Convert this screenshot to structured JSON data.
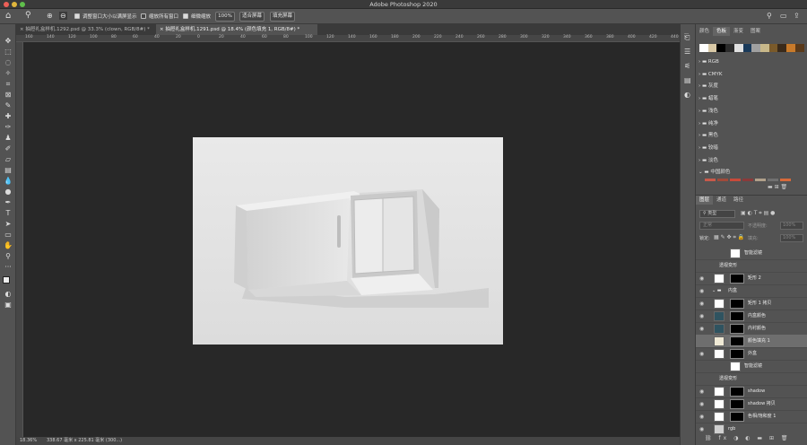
{
  "window": {
    "title": "Adobe Photoshop 2020"
  },
  "options": {
    "resize_label": "调整窗口大小以满屏显示",
    "zoom_all_label": "缩放所有窗口",
    "scrubby_label": "细微缩放",
    "zoom_value": "100%",
    "fit_label": "适合屏幕",
    "fill_label": "填充屏幕"
  },
  "tabs": [
    {
      "label": "抽屉礼盒样机.1292.psd @ 33.3% (clown, RGB/8#) *"
    },
    {
      "label": "抽屉礼盒样机.1291.psd @ 18.4% (颜色填充 1, RGB/8#) *"
    }
  ],
  "ruler": [
    "160",
    "140",
    "120",
    "100",
    "80",
    "60",
    "40",
    "20",
    "0",
    "20",
    "40",
    "60",
    "80",
    "100",
    "120",
    "140",
    "160",
    "180",
    "200",
    "220",
    "240",
    "260",
    "280",
    "300",
    "320",
    "340",
    "360",
    "380",
    "400",
    "420",
    "440",
    "460"
  ],
  "status": {
    "zoom": "18.36%",
    "doc": "338.67 毫米 x 225.81 毫米 (300...)"
  },
  "swatches_panel": {
    "tabs": [
      "颜色",
      "色板",
      "渐变",
      "图案"
    ],
    "active": "色板",
    "colors": [
      "#ffffff",
      "#d9c9a6",
      "#000000",
      "#2b2b2b",
      "#e0e0e0",
      "#1a3a5a",
      "#a0a0a0",
      "#c8b88a",
      "#7a5a2a",
      "#3a2a1a",
      "#c87a2a",
      "#5a3a1a"
    ],
    "groups": [
      "RGB",
      "CMYK",
      "灰度",
      "蜡笔",
      "浅色",
      "纯净",
      "黑色",
      "较暗",
      "淡色",
      "中国颜色"
    ],
    "bottom_colors": [
      "#c85a4a",
      "#a04a3a",
      "#c84a3a",
      "#8a3a3a",
      "#b0a08a",
      "#707070",
      "#d86a3a"
    ]
  },
  "layers_panel": {
    "tabs": [
      "图层",
      "通道",
      "路径"
    ],
    "filter_label": "类型",
    "blend_mode": "正常",
    "opacity_label": "不透明度:",
    "opacity": "100%",
    "lock_label": "锁定:",
    "fill_label": "填充:",
    "fill": "100%"
  },
  "layers": [
    {
      "name": "智能滤镜",
      "kind": "filter"
    },
    {
      "name": "透视变形",
      "kind": "sub"
    },
    {
      "name": "矩形 2",
      "kind": "layer"
    },
    {
      "name": "内盒",
      "kind": "group"
    },
    {
      "name": "矩形 1 拷贝",
      "kind": "layer"
    },
    {
      "name": "内盒颜色",
      "kind": "layer"
    },
    {
      "name": "内衬颜色",
      "kind": "layer"
    },
    {
      "name": "颜色填充 1",
      "kind": "layer"
    },
    {
      "name": "外盒",
      "kind": "layer"
    },
    {
      "name": "智能滤镜",
      "kind": "filter"
    },
    {
      "name": "透视变形",
      "kind": "sub"
    },
    {
      "name": "shadow",
      "kind": "layer"
    },
    {
      "name": "shadow 拷贝",
      "kind": "layer"
    },
    {
      "name": "色相/饱和度 1",
      "kind": "layer"
    },
    {
      "name": "rgb",
      "kind": "layer"
    }
  ],
  "colors": {
    "bg": "#282828",
    "panel": "#535353",
    "active_layer": "#6e6e6e",
    "canvas": "#e6e6e6"
  }
}
